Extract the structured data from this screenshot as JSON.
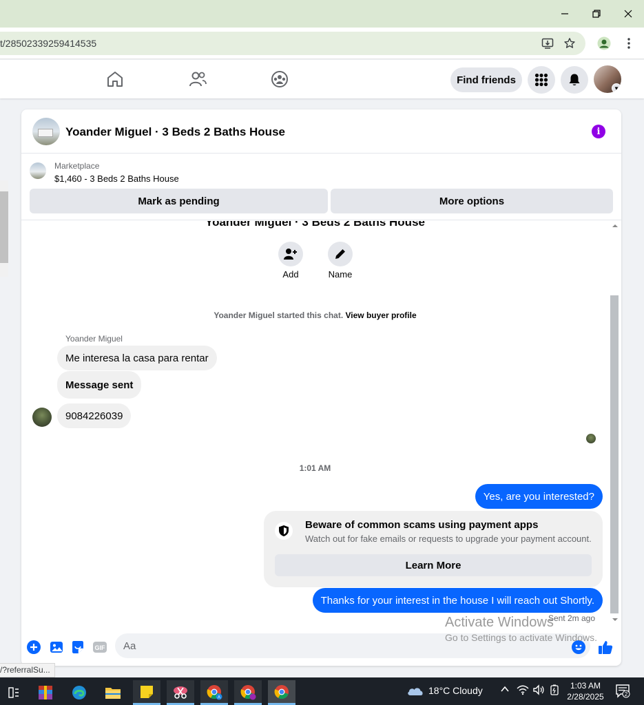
{
  "browser": {
    "url": "t/28502339259414535",
    "status_link": "/?referralSu..."
  },
  "fb_nav": {
    "find_friends_label": "Find friends"
  },
  "chat": {
    "title": "Yoander Miguel · 3 Beds 2 Baths House",
    "listing": {
      "source": "Marketplace",
      "title": "$1,460 - 3 Beds 2 Baths House",
      "mark_pending_label": "Mark as pending",
      "more_options_label": "More options"
    },
    "actions": [
      {
        "label": "Add",
        "icon": "add-person-icon"
      },
      {
        "label": "Name",
        "icon": "pencil-icon"
      }
    ],
    "started_text": "Yoander Miguel started this chat.",
    "buyer_profile_link": "View buyer profile",
    "sender_name": "Yoander Miguel",
    "incoming": [
      {
        "text": "Me interesa la casa para rentar"
      },
      {
        "text": "Message sent"
      },
      {
        "text": "9084226039"
      }
    ],
    "timestamp": "1:01 AM",
    "outgoing_1": "Yes, are you interested?",
    "scam_warning": {
      "title": "Beware of common scams using payment apps",
      "subtitle": "Watch out for fake emails or requests to upgrade your payment account.",
      "button": "Learn More"
    },
    "outgoing_2": "Thanks for your interest in the house I will reach out Shortly.",
    "sent_status": "Sent 2m ago",
    "composer_placeholder": "Aa"
  },
  "watermark": {
    "line1": "Activate Windows",
    "line2": "Go to Settings to activate Windows."
  },
  "taskbar": {
    "weather": "18°C  Cloudy",
    "time": "1:03 AM",
    "date": "2/28/2025",
    "notification_count": "2"
  },
  "colors": {
    "messenger_blue": "#0866ff",
    "info_purple": "#9000e6",
    "title_bar_green": "#dbe8d3"
  }
}
